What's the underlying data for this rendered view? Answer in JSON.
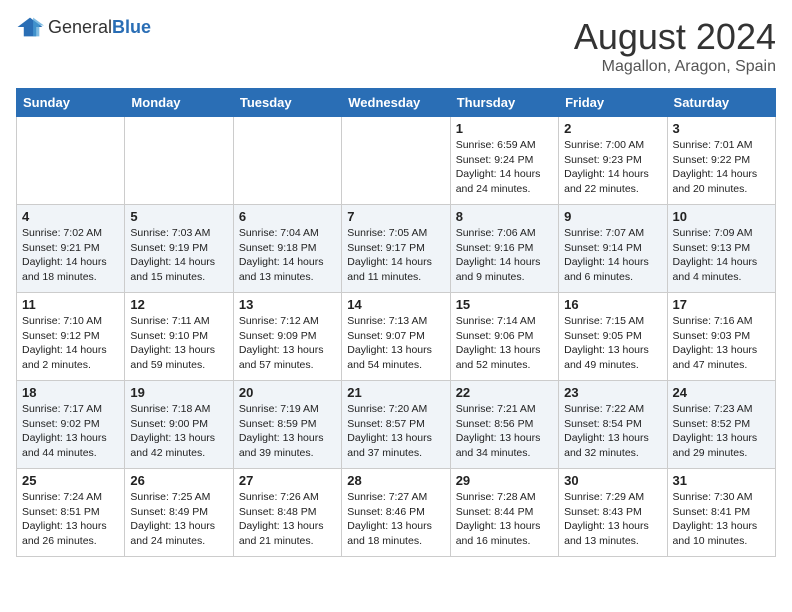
{
  "logo": {
    "text_general": "General",
    "text_blue": "Blue"
  },
  "title": "August 2024",
  "location": "Magallon, Aragon, Spain",
  "weekdays": [
    "Sunday",
    "Monday",
    "Tuesday",
    "Wednesday",
    "Thursday",
    "Friday",
    "Saturday"
  ],
  "weeks": [
    [
      {
        "day": "",
        "info": ""
      },
      {
        "day": "",
        "info": ""
      },
      {
        "day": "",
        "info": ""
      },
      {
        "day": "",
        "info": ""
      },
      {
        "day": "1",
        "info": "Sunrise: 6:59 AM\nSunset: 9:24 PM\nDaylight: 14 hours\nand 24 minutes."
      },
      {
        "day": "2",
        "info": "Sunrise: 7:00 AM\nSunset: 9:23 PM\nDaylight: 14 hours\nand 22 minutes."
      },
      {
        "day": "3",
        "info": "Sunrise: 7:01 AM\nSunset: 9:22 PM\nDaylight: 14 hours\nand 20 minutes."
      }
    ],
    [
      {
        "day": "4",
        "info": "Sunrise: 7:02 AM\nSunset: 9:21 PM\nDaylight: 14 hours\nand 18 minutes."
      },
      {
        "day": "5",
        "info": "Sunrise: 7:03 AM\nSunset: 9:19 PM\nDaylight: 14 hours\nand 15 minutes."
      },
      {
        "day": "6",
        "info": "Sunrise: 7:04 AM\nSunset: 9:18 PM\nDaylight: 14 hours\nand 13 minutes."
      },
      {
        "day": "7",
        "info": "Sunrise: 7:05 AM\nSunset: 9:17 PM\nDaylight: 14 hours\nand 11 minutes."
      },
      {
        "day": "8",
        "info": "Sunrise: 7:06 AM\nSunset: 9:16 PM\nDaylight: 14 hours\nand 9 minutes."
      },
      {
        "day": "9",
        "info": "Sunrise: 7:07 AM\nSunset: 9:14 PM\nDaylight: 14 hours\nand 6 minutes."
      },
      {
        "day": "10",
        "info": "Sunrise: 7:09 AM\nSunset: 9:13 PM\nDaylight: 14 hours\nand 4 minutes."
      }
    ],
    [
      {
        "day": "11",
        "info": "Sunrise: 7:10 AM\nSunset: 9:12 PM\nDaylight: 14 hours\nand 2 minutes."
      },
      {
        "day": "12",
        "info": "Sunrise: 7:11 AM\nSunset: 9:10 PM\nDaylight: 13 hours\nand 59 minutes."
      },
      {
        "day": "13",
        "info": "Sunrise: 7:12 AM\nSunset: 9:09 PM\nDaylight: 13 hours\nand 57 minutes."
      },
      {
        "day": "14",
        "info": "Sunrise: 7:13 AM\nSunset: 9:07 PM\nDaylight: 13 hours\nand 54 minutes."
      },
      {
        "day": "15",
        "info": "Sunrise: 7:14 AM\nSunset: 9:06 PM\nDaylight: 13 hours\nand 52 minutes."
      },
      {
        "day": "16",
        "info": "Sunrise: 7:15 AM\nSunset: 9:05 PM\nDaylight: 13 hours\nand 49 minutes."
      },
      {
        "day": "17",
        "info": "Sunrise: 7:16 AM\nSunset: 9:03 PM\nDaylight: 13 hours\nand 47 minutes."
      }
    ],
    [
      {
        "day": "18",
        "info": "Sunrise: 7:17 AM\nSunset: 9:02 PM\nDaylight: 13 hours\nand 44 minutes."
      },
      {
        "day": "19",
        "info": "Sunrise: 7:18 AM\nSunset: 9:00 PM\nDaylight: 13 hours\nand 42 minutes."
      },
      {
        "day": "20",
        "info": "Sunrise: 7:19 AM\nSunset: 8:59 PM\nDaylight: 13 hours\nand 39 minutes."
      },
      {
        "day": "21",
        "info": "Sunrise: 7:20 AM\nSunset: 8:57 PM\nDaylight: 13 hours\nand 37 minutes."
      },
      {
        "day": "22",
        "info": "Sunrise: 7:21 AM\nSunset: 8:56 PM\nDaylight: 13 hours\nand 34 minutes."
      },
      {
        "day": "23",
        "info": "Sunrise: 7:22 AM\nSunset: 8:54 PM\nDaylight: 13 hours\nand 32 minutes."
      },
      {
        "day": "24",
        "info": "Sunrise: 7:23 AM\nSunset: 8:52 PM\nDaylight: 13 hours\nand 29 minutes."
      }
    ],
    [
      {
        "day": "25",
        "info": "Sunrise: 7:24 AM\nSunset: 8:51 PM\nDaylight: 13 hours\nand 26 minutes."
      },
      {
        "day": "26",
        "info": "Sunrise: 7:25 AM\nSunset: 8:49 PM\nDaylight: 13 hours\nand 24 minutes."
      },
      {
        "day": "27",
        "info": "Sunrise: 7:26 AM\nSunset: 8:48 PM\nDaylight: 13 hours\nand 21 minutes."
      },
      {
        "day": "28",
        "info": "Sunrise: 7:27 AM\nSunset: 8:46 PM\nDaylight: 13 hours\nand 18 minutes."
      },
      {
        "day": "29",
        "info": "Sunrise: 7:28 AM\nSunset: 8:44 PM\nDaylight: 13 hours\nand 16 minutes."
      },
      {
        "day": "30",
        "info": "Sunrise: 7:29 AM\nSunset: 8:43 PM\nDaylight: 13 hours\nand 13 minutes."
      },
      {
        "day": "31",
        "info": "Sunrise: 7:30 AM\nSunset: 8:41 PM\nDaylight: 13 hours\nand 10 minutes."
      }
    ]
  ]
}
